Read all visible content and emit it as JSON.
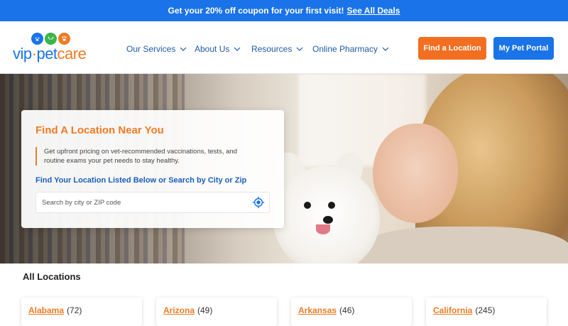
{
  "promo": {
    "text": "Get your 20% off coupon for your first visit!",
    "link": "See All Deals"
  },
  "logo": {
    "vip": "vip",
    "dot": "·",
    "pet": "pet",
    "care": "care"
  },
  "nav": {
    "items": [
      "Our Services",
      "About Us",
      "Resources",
      "Online Pharmacy"
    ],
    "find_location": "Find a Location",
    "pet_portal": "My Pet Portal"
  },
  "hero": {
    "title": "Find A Location Near You",
    "description": "Get upfront pricing on vet-recommended vaccinations, tests, and routine exams your pet needs to stay healthy.",
    "subheading": "Find Your Location Listed Below or Search by City or Zip",
    "search_placeholder": "Search by city or ZIP code"
  },
  "locations": {
    "title": "All Locations",
    "items": [
      {
        "state": "Alabama",
        "count": "(72)"
      },
      {
        "state": "Arizona",
        "count": "(49)"
      },
      {
        "state": "Arkansas",
        "count": "(46)"
      },
      {
        "state": "California",
        "count": "(245)"
      }
    ]
  },
  "colors": {
    "brand_blue": "#1a73e8",
    "brand_orange": "#f26f21"
  }
}
